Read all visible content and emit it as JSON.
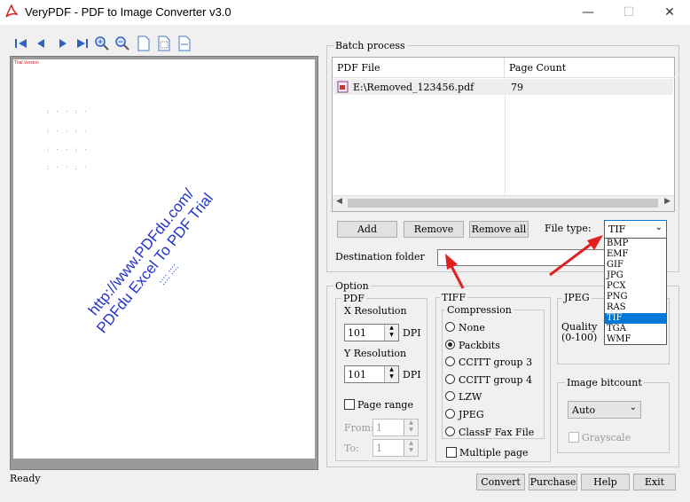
{
  "window": {
    "title": "VeryPDF - PDF to Image Converter v3.0",
    "minimize_glyph": "—",
    "maximize_glyph": "☐",
    "close_glyph": "✕"
  },
  "toolbar": {
    "icons": [
      "first-page-icon",
      "prev-page-icon",
      "next-page-icon",
      "last-page-icon",
      "zoom-in-icon",
      "zoom-out-icon",
      "page-icon",
      "page-fit-icon",
      "page-width-icon"
    ]
  },
  "preview": {
    "trial_tag": "Trial Version",
    "watermark_line1": "http://www.PDFdu.com/",
    "watermark_line2": "PDFdu Excel To PDF Trial",
    "watermark_line3": ":::: ::::",
    "dot_rows": [
      ": ·  · :  ·",
      ": ·  · :  ·",
      ": ·  · :  ·",
      ": ·  · :  ·"
    ]
  },
  "status_text": "Ready",
  "batch": {
    "label": "Batch process",
    "columns": [
      "PDF File",
      "Page Count"
    ],
    "rows": [
      {
        "file": "E:\\Removed_123456.pdf",
        "pages": "79"
      }
    ],
    "add": "Add",
    "remove": "Remove",
    "remove_all": "Remove all",
    "file_type_label": "File type:",
    "file_type_value": "TIF",
    "dest_label": "Destination folder",
    "dest_value": "",
    "file_types": [
      "BMP",
      "EMF",
      "GIF",
      "JPG",
      "PCX",
      "PNG",
      "RAS",
      "TIF",
      "TGA",
      "WMF"
    ],
    "selected_type": "TIF"
  },
  "option": {
    "label": "Option",
    "pdf_label": "PDF",
    "xres_label": "X Resolution",
    "xres_value": "101",
    "yres_label": "Y Resolution",
    "yres_value": "101",
    "dpi": "DPI",
    "page_range": "Page range",
    "from_label": "From:",
    "from_value": "1",
    "to_label": "To:",
    "to_value": "1",
    "tiff_label": "TIFF",
    "compression_label": "Compression",
    "compressions": [
      "None",
      "Packbits",
      "CCITT group 3",
      "CCITT group 4",
      "LZW",
      "JPEG",
      "ClassF Fax File"
    ],
    "selected_compression": "Packbits",
    "multiple_page": "Multiple page",
    "jpeg_label": "JPEG",
    "quality_label": "Quality",
    "quality_range": "(0-100)",
    "bitcount_label": "Image bitcount",
    "bitcount_value": "Auto",
    "grayscale": "Grayscale"
  },
  "buttons": {
    "convert": "Convert",
    "purchase": "Purchase",
    "help": "Help",
    "exit": "Exit"
  },
  "colors": {
    "selection": "#0078d7",
    "annotation_arrow": "#e02020",
    "watermark": "#2233cc"
  }
}
